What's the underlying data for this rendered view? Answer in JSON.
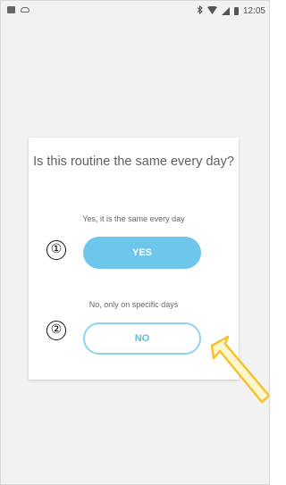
{
  "status_bar": {
    "time": "12:05",
    "icons_left": [
      "image-icon",
      "cloud-icon"
    ],
    "icons_right": [
      "bluetooth-icon",
      "wifi-icon",
      "signal-icon",
      "battery-icon"
    ]
  },
  "dialog": {
    "question": "Is this routine the same every day?",
    "yes_hint": "Yes, it is the same every day",
    "yes_label": "YES",
    "no_hint": "No, only on specific days",
    "no_label": "NO"
  },
  "annotations": {
    "marker_1": "①",
    "marker_2": "②",
    "arrow_color": "#f2c230"
  },
  "colors": {
    "yes_button": "#6ec6ec",
    "no_button_border": "#8fd3f0",
    "no_button_text": "#5cbde6"
  }
}
